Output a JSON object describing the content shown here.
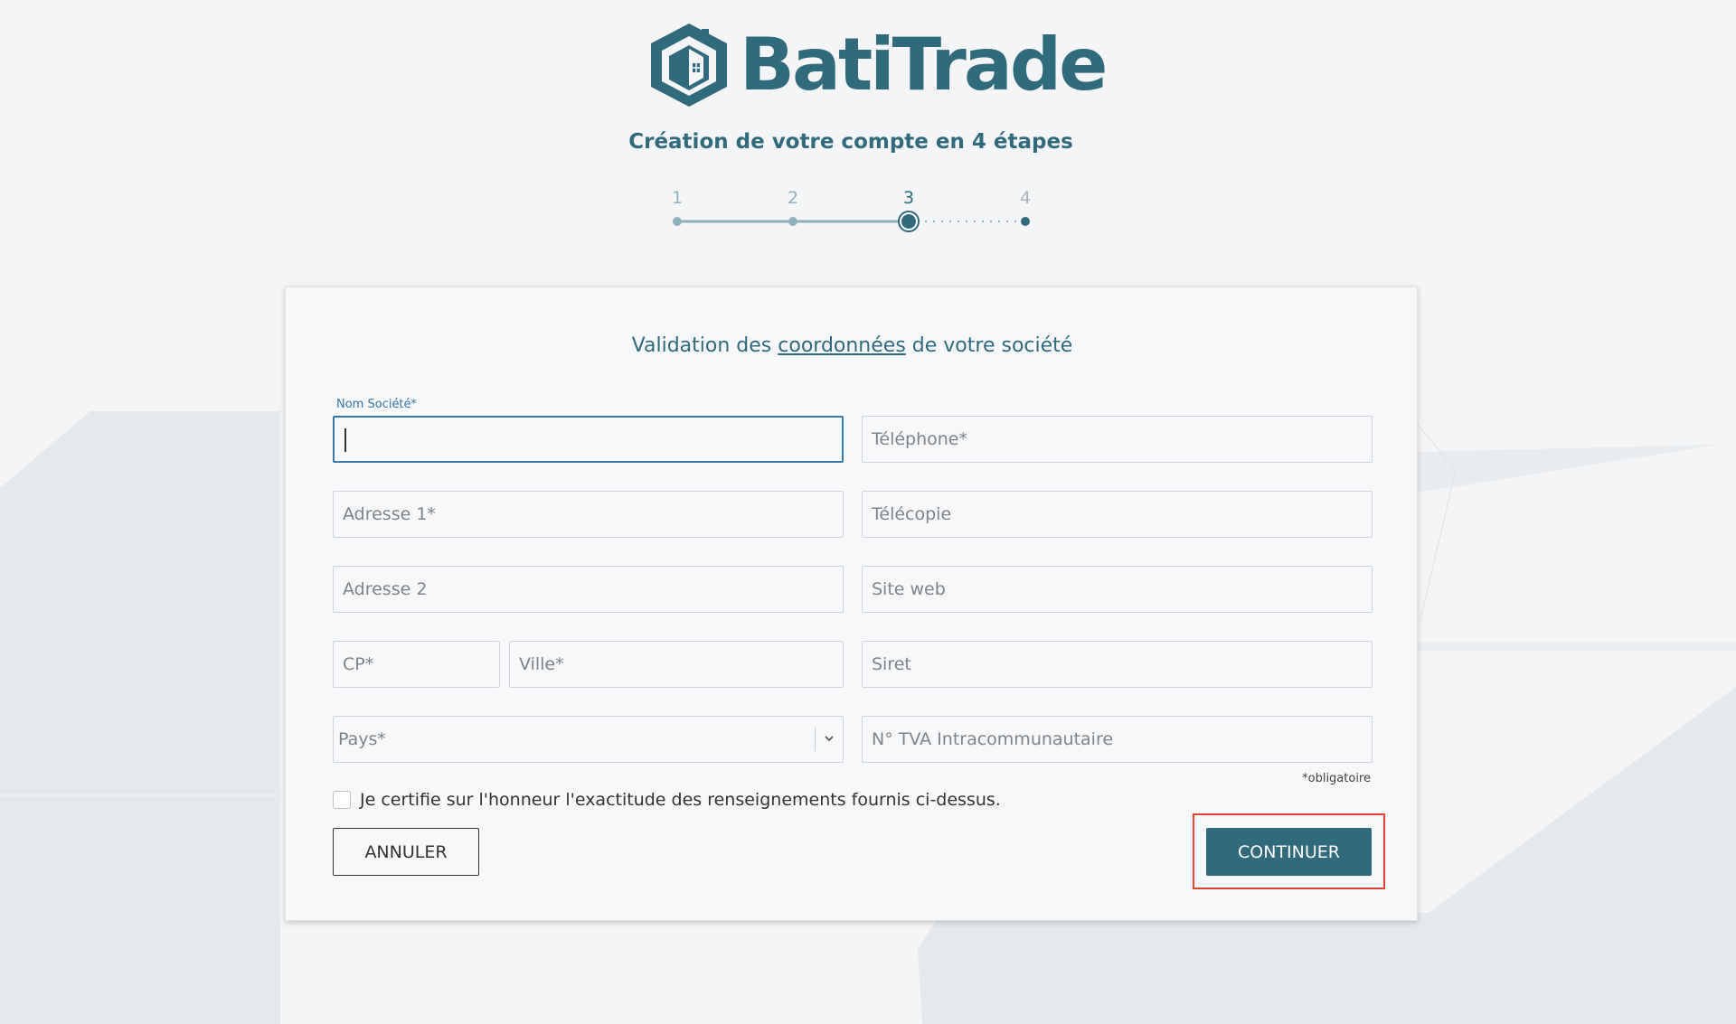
{
  "brand": {
    "name": "BatiTrade",
    "color": "#2f6b7d"
  },
  "header": {
    "subtitle": "Création de votre compte en 4 étapes"
  },
  "stepper": {
    "steps": [
      "1",
      "2",
      "3",
      "4"
    ],
    "current": 3
  },
  "form": {
    "title_before": "Validation des ",
    "title_link": "coordonnées",
    "title_after": " de votre société",
    "fields": {
      "nom_societe": {
        "label": "Nom Société*",
        "value": ""
      },
      "telephone": {
        "placeholder": "Téléphone*"
      },
      "adresse1": {
        "placeholder": "Adresse 1*"
      },
      "telecopie": {
        "placeholder": "Télécopie"
      },
      "adresse2": {
        "placeholder": "Adresse 2"
      },
      "site_web": {
        "placeholder": "Site web"
      },
      "cp": {
        "placeholder": "CP*"
      },
      "ville": {
        "placeholder": "Ville*"
      },
      "siret": {
        "placeholder": "Siret"
      },
      "pays": {
        "placeholder": "Pays*"
      },
      "tva": {
        "placeholder": "N° TVA Intracommunautaire"
      }
    },
    "required_note": "*obligatoire",
    "certify_label": "Je certifie sur l'honneur l'exactitude des renseignements fournis ci-dessus.",
    "cancel_label": "ANNULER",
    "continue_label": "CONTINUER",
    "highlight_color": "#e2452f"
  }
}
